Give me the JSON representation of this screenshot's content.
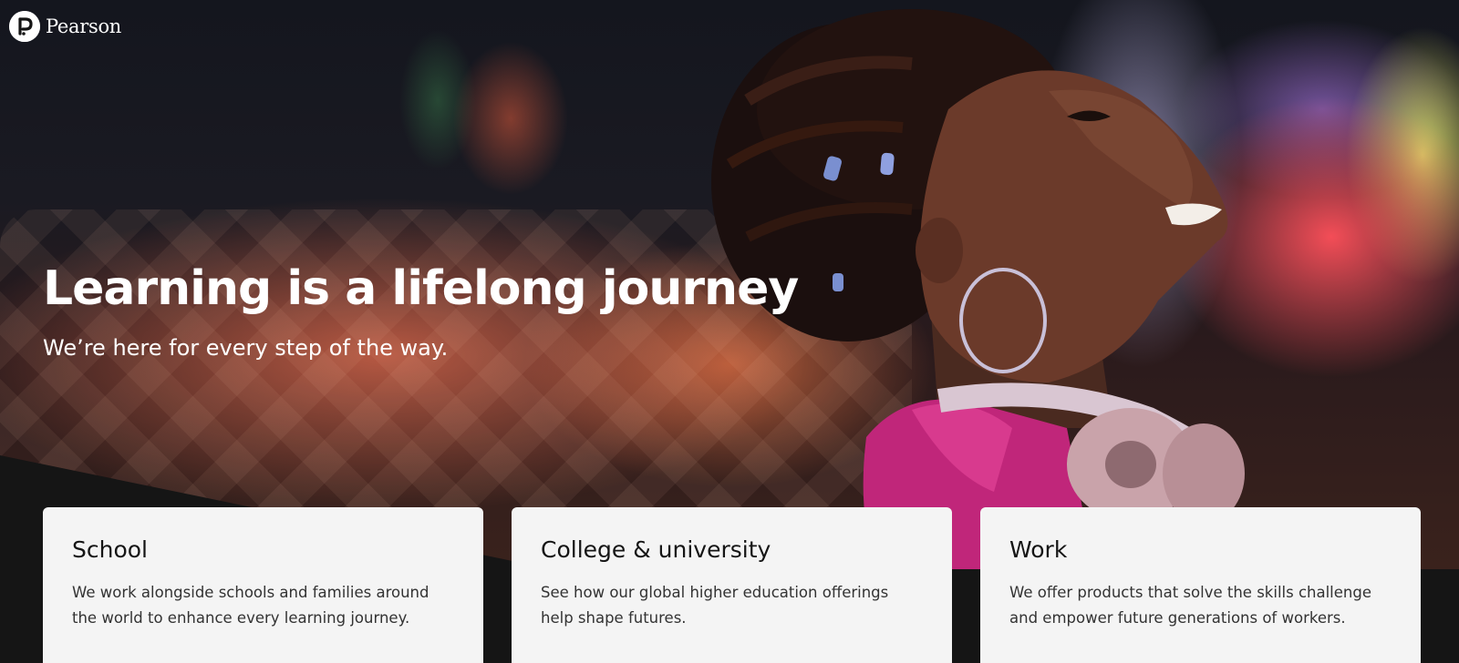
{
  "brand": {
    "name": "Pearson",
    "logo_icon": "pearson-p-icon",
    "colors": {
      "hero_text": "#ffffff",
      "card_bg": "#f4f4f4",
      "page_bg": "#151515"
    }
  },
  "hero": {
    "headline": "Learning is a lifelong journey",
    "subheadline": "We’re here for every step of the way."
  },
  "cards": [
    {
      "title": "School",
      "description": "We work alongside schools and families around the world to enhance every learning journey."
    },
    {
      "title": "College & university",
      "description": "See how our global higher education offerings help shape futures."
    },
    {
      "title": "Work",
      "description": "We offer products that solve the skills challenge and empower future generations of workers."
    }
  ]
}
